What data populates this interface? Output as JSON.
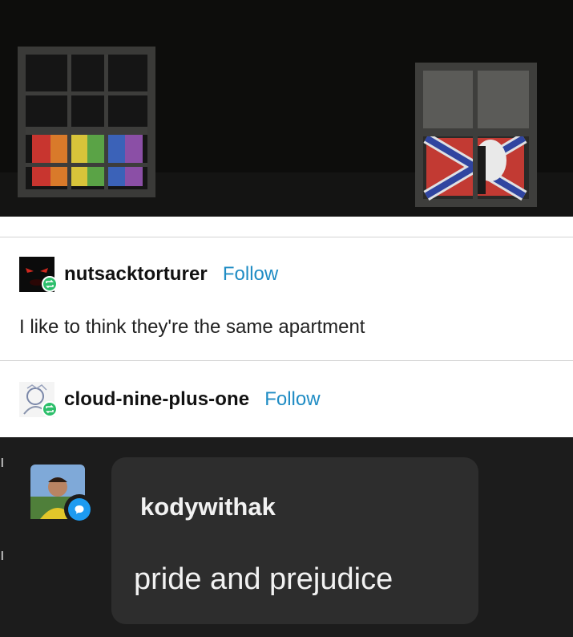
{
  "photo": {
    "description_icons": [
      "pride-flag-window",
      "confederate-flag-window"
    ]
  },
  "posts": [
    {
      "username": "nutsacktorturer",
      "follow_label": "Follow",
      "text": "I like to think they're the same apartment",
      "avatar_icon": "dark-face-avatar",
      "badge_icon": "reblog-icon"
    },
    {
      "username": "cloud-nine-plus-one",
      "follow_label": "Follow",
      "avatar_icon": "sketch-avatar",
      "badge_icon": "reblog-icon"
    }
  ],
  "reply": {
    "username": "kodywithak",
    "text": "pride and prejudice",
    "avatar_icon": "person-photo-avatar",
    "badge_icon": "chat-bubble-icon"
  },
  "colors": {
    "follow": "#1f8cc4",
    "reblog_badge": "#2dbf6b",
    "chat_badge": "#1d9bf0",
    "dark_bg": "#1c1c1c",
    "bubble_bg": "#2d2d2d"
  }
}
